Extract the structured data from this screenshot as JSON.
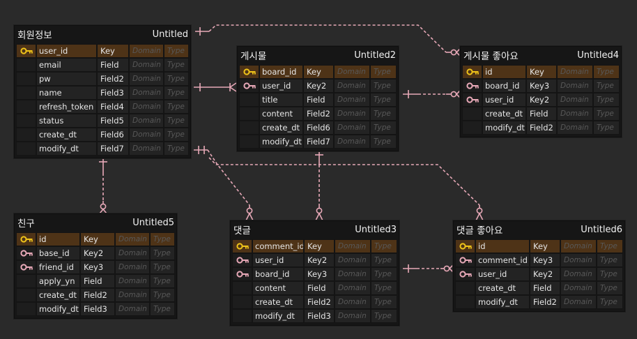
{
  "column_headers": {
    "domain": "Domain",
    "type": "Type"
  },
  "colors": {
    "background": "#2a2a2a",
    "connector": "#e8a9b8",
    "pk_row": "#4e3317",
    "pk_key": "#f0c419",
    "fk_key": "#e8a9b8"
  },
  "entities": [
    {
      "id": "member",
      "name": "회원정보",
      "table": "Untitled",
      "fields": [
        {
          "name": "user_id",
          "key": "Key",
          "icon": "primary-key-icon"
        },
        {
          "name": "email",
          "key": "Field",
          "icon": ""
        },
        {
          "name": "pw",
          "key": "Field2",
          "icon": ""
        },
        {
          "name": "name",
          "key": "Field3",
          "icon": ""
        },
        {
          "name": "refresh_token",
          "key": "Field4",
          "icon": ""
        },
        {
          "name": "status",
          "key": "Field5",
          "icon": ""
        },
        {
          "name": "create_dt",
          "key": "Field6",
          "icon": ""
        },
        {
          "name": "modify_dt",
          "key": "Field7",
          "icon": ""
        }
      ]
    },
    {
      "id": "post",
      "name": "게시물",
      "table": "Untitled2",
      "fields": [
        {
          "name": "board_id",
          "key": "Key",
          "icon": "primary-key-icon"
        },
        {
          "name": "user_id",
          "key": "Key2",
          "icon": "foreign-key-icon"
        },
        {
          "name": "title",
          "key": "Field",
          "icon": ""
        },
        {
          "name": "content",
          "key": "Field2",
          "icon": ""
        },
        {
          "name": "create_dt",
          "key": "Field6",
          "icon": ""
        },
        {
          "name": "modify_dt",
          "key": "Field7",
          "icon": ""
        }
      ]
    },
    {
      "id": "post_like",
      "name": "게시물 좋아요",
      "table": "Untitled4",
      "fields": [
        {
          "name": "id",
          "key": "Key",
          "icon": "primary-key-icon"
        },
        {
          "name": "board_id",
          "key": "Key3",
          "icon": "foreign-key-icon"
        },
        {
          "name": "user_id",
          "key": "Key2",
          "icon": "foreign-key-icon"
        },
        {
          "name": "create_dt",
          "key": "Field",
          "icon": ""
        },
        {
          "name": "modify_dt",
          "key": "Field2",
          "icon": ""
        }
      ]
    },
    {
      "id": "friend",
      "name": "친구",
      "table": "Untitled5",
      "fields": [
        {
          "name": "id",
          "key": "Key",
          "icon": "primary-key-icon"
        },
        {
          "name": "base_id",
          "key": "Key2",
          "icon": "foreign-key-icon"
        },
        {
          "name": "friend_id",
          "key": "Key3",
          "icon": "foreign-key-icon"
        },
        {
          "name": "apply_yn",
          "key": "Field",
          "icon": ""
        },
        {
          "name": "create_dt",
          "key": "Field2",
          "icon": ""
        },
        {
          "name": "modify_dt",
          "key": "Field3",
          "icon": ""
        }
      ]
    },
    {
      "id": "comment",
      "name": "댓글",
      "table": "Untitled3",
      "fields": [
        {
          "name": "comment_id",
          "key": "Key",
          "icon": "primary-key-icon"
        },
        {
          "name": "user_id",
          "key": "Key2",
          "icon": "foreign-key-icon"
        },
        {
          "name": "board_id",
          "key": "Key3",
          "icon": "foreign-key-icon"
        },
        {
          "name": "content",
          "key": "Field",
          "icon": ""
        },
        {
          "name": "create_dt",
          "key": "Field2",
          "icon": ""
        },
        {
          "name": "modify_dt",
          "key": "Field3",
          "icon": ""
        }
      ]
    },
    {
      "id": "comment_like",
      "name": "댓글 좋아요",
      "table": "Untitled6",
      "fields": [
        {
          "name": "id",
          "key": "Key",
          "icon": "primary-key-icon"
        },
        {
          "name": "comment_id",
          "key": "Key3",
          "icon": "foreign-key-icon"
        },
        {
          "name": "user_id",
          "key": "Key2",
          "icon": "foreign-key-icon"
        },
        {
          "name": "create_dt",
          "key": "Field",
          "icon": ""
        },
        {
          "name": "modify_dt",
          "key": "Field2",
          "icon": ""
        }
      ]
    }
  ],
  "relationships": [
    {
      "from": "member",
      "to": "post",
      "cardinality": "one-to-many"
    },
    {
      "from": "member",
      "to": "post_like",
      "cardinality": "one-to-zero-or-many"
    },
    {
      "from": "post",
      "to": "post_like",
      "cardinality": "one-to-zero-or-many"
    },
    {
      "from": "member",
      "to": "friend",
      "cardinality": "one-to-zero-or-many"
    },
    {
      "from": "member",
      "to": "comment",
      "cardinality": "one-to-zero-or-many"
    },
    {
      "from": "member",
      "to": "comment_like",
      "cardinality": "one-to-zero-or-many"
    },
    {
      "from": "post",
      "to": "comment",
      "cardinality": "one-to-zero-or-many"
    },
    {
      "from": "comment",
      "to": "comment_like",
      "cardinality": "one-to-zero-or-many"
    }
  ]
}
